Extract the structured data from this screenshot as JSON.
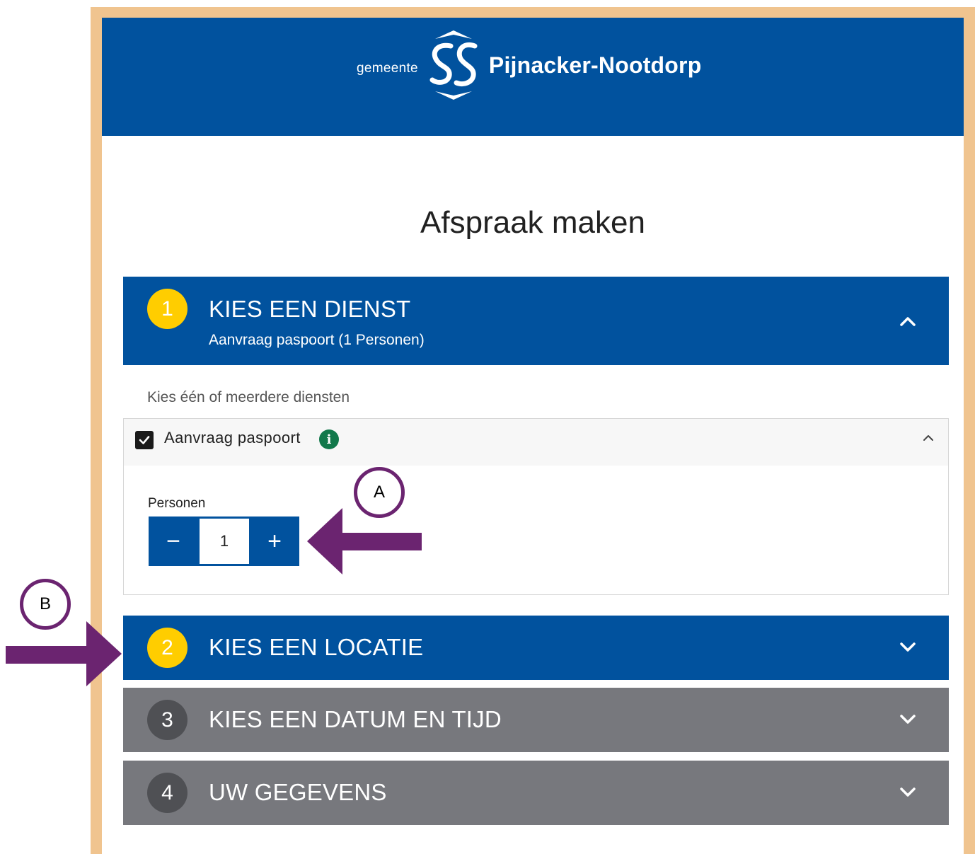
{
  "header": {
    "prefix": "gemeente",
    "name": "Pijnacker-Nootdorp",
    "color": "#01529E"
  },
  "page_title": "Afspraak maken",
  "steps": [
    {
      "number": "1",
      "title": "KIES EEN DIENST",
      "subtitle": "Aanvraag paspoort (1 Personen)",
      "state": "active",
      "expanded": true,
      "icon": "chevron-up-icon"
    },
    {
      "number": "2",
      "title": "KIES EEN LOCATIE",
      "state": "active",
      "expanded": false,
      "icon": "chevron-down-icon"
    },
    {
      "number": "3",
      "title": "KIES EEN DATUM EN TIJD",
      "state": "disabled",
      "expanded": false,
      "icon": "chevron-down-icon"
    },
    {
      "number": "4",
      "title": "UW GEGEVENS",
      "state": "disabled",
      "expanded": false,
      "icon": "chevron-down-icon"
    }
  ],
  "services": {
    "hint": "Kies één of meerdere diensten",
    "items": [
      {
        "label": "Aanvraag paspoort",
        "checked": true,
        "info_icon": "info-icon",
        "persons_label": "Personen",
        "persons_value": "1",
        "minus": "−",
        "plus": "+"
      }
    ]
  },
  "annotations": [
    {
      "label": "A",
      "target": "persons-stepper"
    },
    {
      "label": "B",
      "target": "step-2-header"
    }
  ],
  "colors": {
    "accent": "#01529E",
    "badge_active": "#FFCD00",
    "disabled": "#77787D",
    "annotation": "#6B2470",
    "frame": "#F0C48F",
    "info": "#12784B"
  }
}
